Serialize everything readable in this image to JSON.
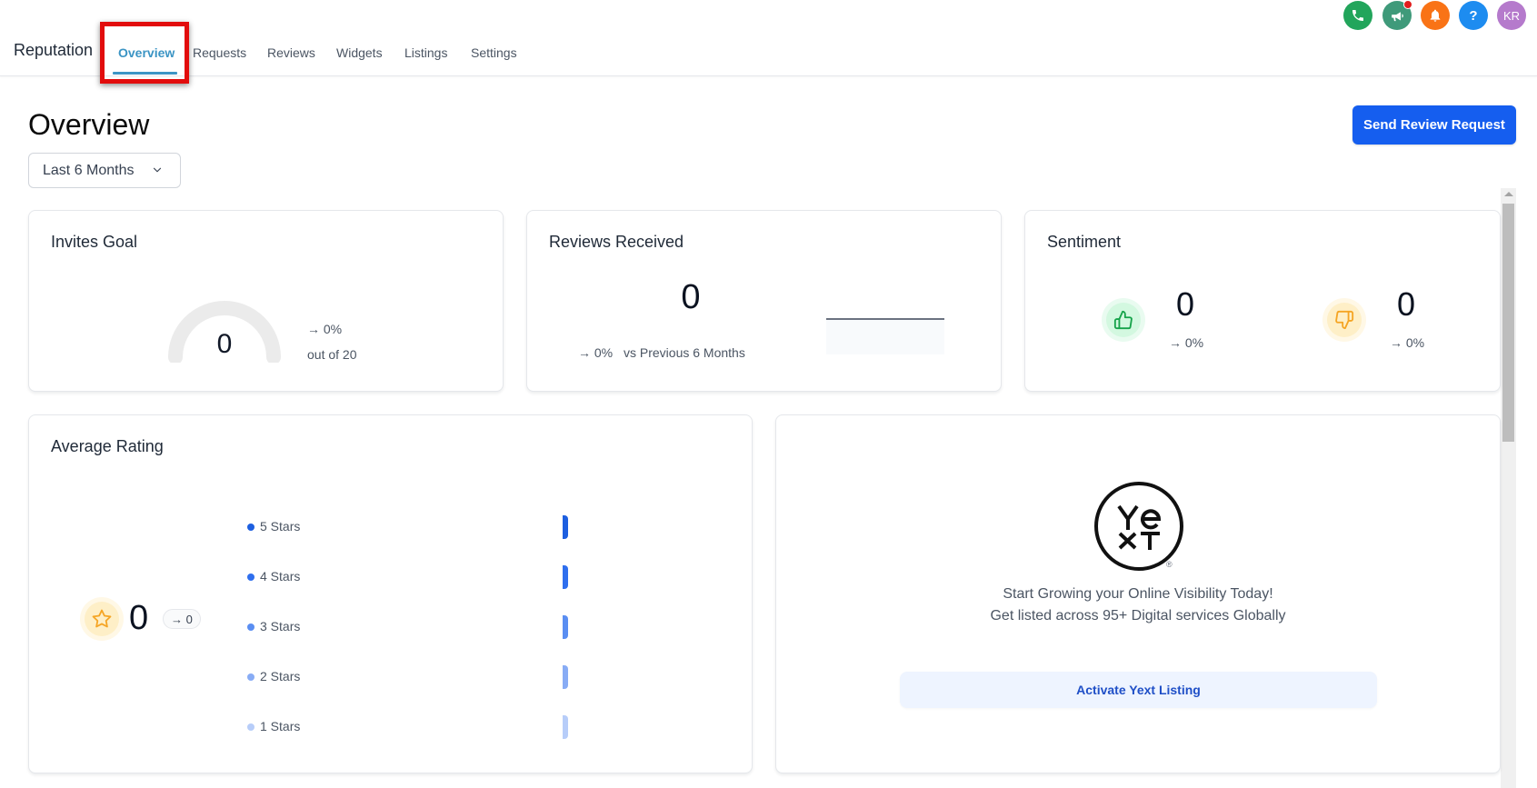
{
  "nav": {
    "app_title": "Reputation",
    "tabs": [
      {
        "label": "Overview",
        "active": true
      },
      {
        "label": "Requests",
        "active": false
      },
      {
        "label": "Reviews",
        "active": false
      },
      {
        "label": "Widgets",
        "active": false
      },
      {
        "label": "Listings",
        "active": false
      },
      {
        "label": "Settings",
        "active": false
      }
    ],
    "top_icons": [
      {
        "name": "phone-icon",
        "color": "#22a55b"
      },
      {
        "name": "megaphone-icon",
        "color": "#3f9a7a",
        "has_notification": true
      },
      {
        "name": "bell-icon",
        "color": "#f97316"
      },
      {
        "name": "help-icon",
        "color": "#1d8cf0",
        "label": "?"
      },
      {
        "name": "avatar",
        "color": "#b57acc",
        "label": "KR"
      }
    ]
  },
  "header": {
    "title": "Overview",
    "date_range": "Last 6 Months",
    "send_button": "Send Review Request"
  },
  "invites_goal": {
    "title": "Invites Goal",
    "value": "0",
    "trend": "→ 0%",
    "out_of": "out of 20",
    "progress_fraction": 0
  },
  "reviews_received": {
    "title": "Reviews Received",
    "value": "0",
    "trend": "→ 0%",
    "comparison": "vs Previous 6 Months"
  },
  "sentiment": {
    "title": "Sentiment",
    "positive": {
      "value": "0",
      "trend": "→ 0%"
    },
    "negative": {
      "value": "0",
      "trend": "→ 0%"
    }
  },
  "average_rating": {
    "title": "Average Rating",
    "value": "0",
    "delta": "→ 0",
    "breakdown": [
      {
        "label": "5 Stars",
        "count": 0,
        "color": "#1d5fe0"
      },
      {
        "label": "4 Stars",
        "count": 0,
        "color": "#2f6fee"
      },
      {
        "label": "3 Stars",
        "count": 0,
        "color": "#5a8ef2"
      },
      {
        "label": "2 Stars",
        "count": 0,
        "color": "#88acf5"
      },
      {
        "label": "1 Stars",
        "count": 0,
        "color": "#b7cdf9"
      }
    ]
  },
  "yext": {
    "line1": "Start Growing your Online Visibility Today!",
    "line2": "Get listed across 95+ Digital services Globally",
    "button": "Activate Yext Listing",
    "reg_mark": "®"
  }
}
